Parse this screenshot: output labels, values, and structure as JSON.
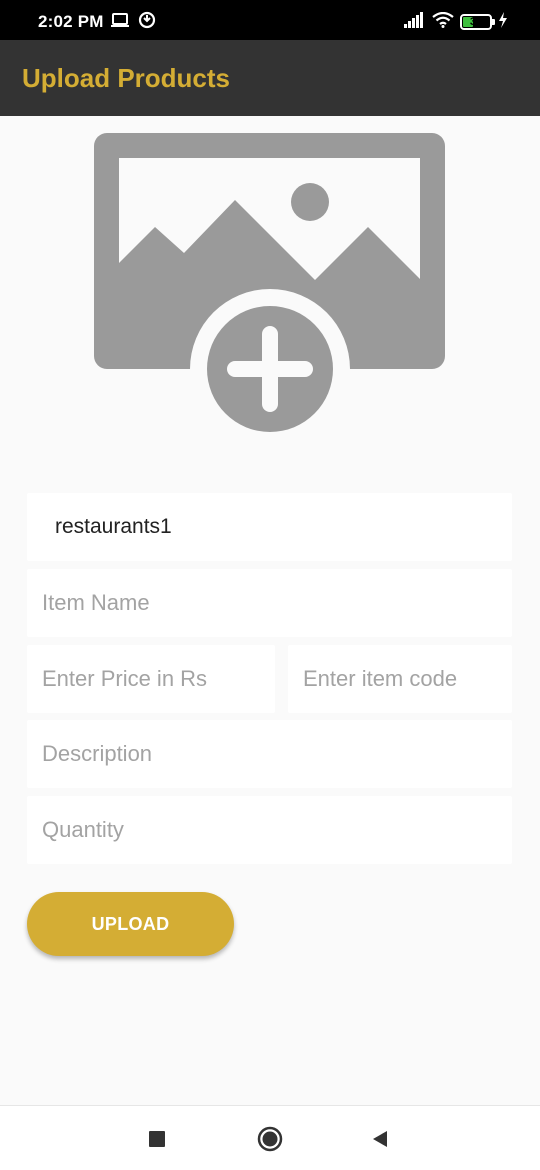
{
  "status_bar": {
    "time": "2:02 PM",
    "battery_level": "34"
  },
  "app_bar": {
    "title": "Upload Products"
  },
  "image_picker": {
    "icon": "add-photo-icon",
    "color": "#9a9a9a"
  },
  "form": {
    "restaurant_value": "restaurants1",
    "item_name_placeholder": "Item Name",
    "price_placeholder": "Enter Price in Rs",
    "item_code_placeholder": "Enter item code",
    "description_placeholder": "Description",
    "quantity_placeholder": "Quantity"
  },
  "upload_button": {
    "label": "UPLOAD"
  },
  "colors": {
    "accent": "#d4ad34",
    "app_bar": "#333333",
    "background": "#fafafa"
  }
}
